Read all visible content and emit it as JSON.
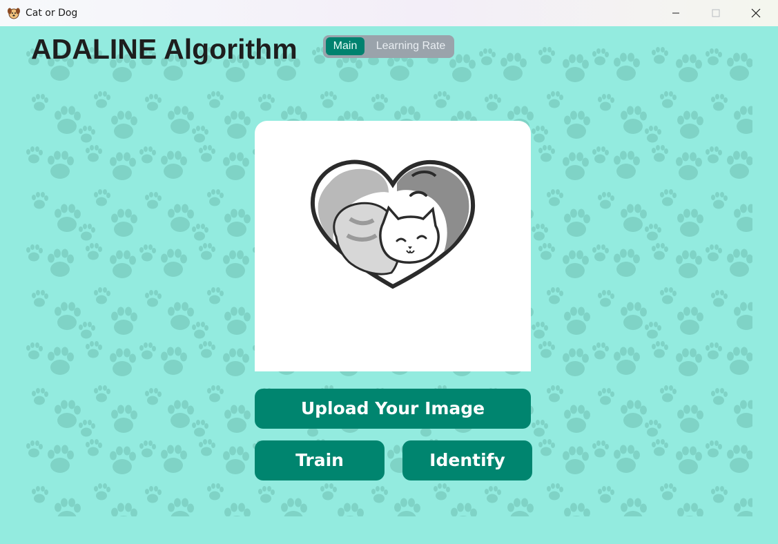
{
  "window": {
    "title": "Cat or Dog",
    "app_icon": "dog-face-icon",
    "controls": [
      "minimize-icon",
      "maximize-icon",
      "close-icon"
    ]
  },
  "header": {
    "title": "ADALINE Algorithm"
  },
  "tabs": {
    "items": [
      {
        "label": "Main",
        "selected": true
      },
      {
        "label": "Learning Rate",
        "selected": false
      }
    ]
  },
  "image_panel": {
    "content": "cat-dog-heart-icon"
  },
  "actions": {
    "upload_label": "Upload Your Image",
    "train_label": "Train",
    "identify_label": "Identify"
  },
  "colors": {
    "background": "#93ebdf",
    "paw_pattern": "#7fd3c6",
    "accent": "#00856f",
    "segment_track": "#9aa3ab",
    "heading_text": "#1e1e1e",
    "button_text": "#ffffff"
  }
}
